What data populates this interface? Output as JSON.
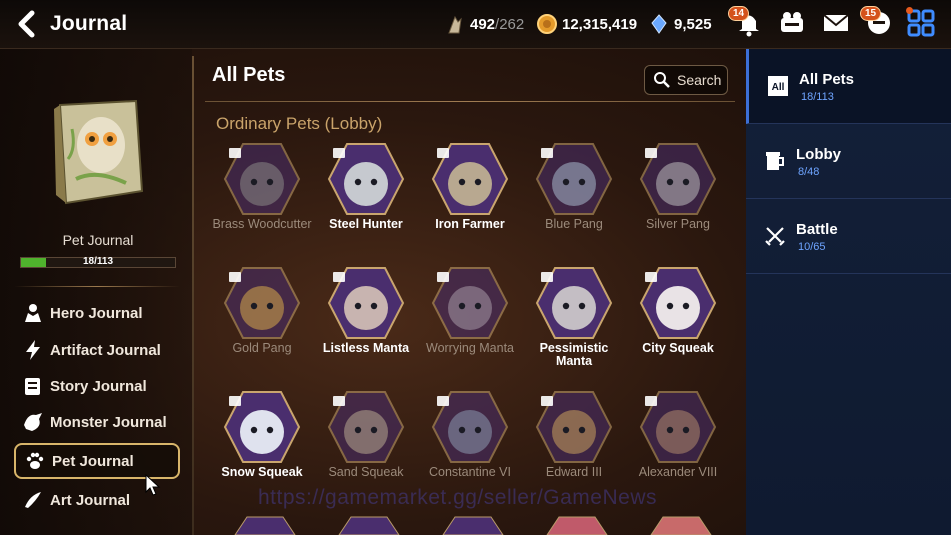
{
  "header": {
    "title": "Journal",
    "stamina": "492",
    "stamina_max": "/262",
    "gold": "12,315,419",
    "crystals": "9,525",
    "notif_badge": "14",
    "chat_badge": "15"
  },
  "left": {
    "book_label": "Pet Journal",
    "progress_text": "18/113",
    "progress_fraction": 0.16,
    "menu": [
      {
        "label": "Hero Journal",
        "icon": "hero-icon"
      },
      {
        "label": "Artifact Journal",
        "icon": "artifact-icon"
      },
      {
        "label": "Story Journal",
        "icon": "story-icon"
      },
      {
        "label": "Monster Journal",
        "icon": "monster-icon"
      },
      {
        "label": "Pet Journal",
        "icon": "paw-icon"
      },
      {
        "label": "Art Journal",
        "icon": "art-icon"
      }
    ]
  },
  "main": {
    "title": "All Pets",
    "search_label": "Search",
    "section_title": "Ordinary Pets (Lobby)",
    "pets": [
      {
        "name": "Brass Woodcutter",
        "owned": false,
        "color": "#8a8a86"
      },
      {
        "name": "Steel Hunter",
        "owned": true,
        "color": "#c6c9cf"
      },
      {
        "name": "Iron Farmer",
        "owned": true,
        "color": "#b8a890"
      },
      {
        "name": "Blue Pang",
        "owned": false,
        "color": "#a7b9cc"
      },
      {
        "name": "Silver Pang",
        "owned": false,
        "color": "#bdbdbd"
      },
      {
        "name": "Gold Pang",
        "owned": false,
        "color": "#d7a94a"
      },
      {
        "name": "Listless Manta",
        "owned": true,
        "color": "#c8b4b0"
      },
      {
        "name": "Worrying Manta",
        "owned": false,
        "color": "#a89aa8"
      },
      {
        "name": "Pessimistic Manta",
        "owned": true,
        "color": "#c4bec4"
      },
      {
        "name": "City Squeak",
        "owned": true,
        "color": "#e9e3e6"
      },
      {
        "name": "Snow Squeak",
        "owned": true,
        "color": "#dfe2ee"
      },
      {
        "name": "Sand Squeak",
        "owned": false,
        "color": "#b8a98f"
      },
      {
        "name": "Constantine VI",
        "owned": false,
        "color": "#8c9bb1"
      },
      {
        "name": "Edward III",
        "owned": false,
        "color": "#caa35c"
      },
      {
        "name": "Alexander VIII",
        "owned": false,
        "color": "#b08a6e"
      }
    ],
    "watermark": "https://gamemarket.gg/seller/GameNews"
  },
  "right": {
    "tabs": [
      {
        "label": "All Pets",
        "count": "18/113",
        "icon": "all-icon"
      },
      {
        "label": "Lobby",
        "count": "8/48",
        "icon": "mug-icon"
      },
      {
        "label": "Battle",
        "count": "10/65",
        "icon": "swords-icon"
      }
    ]
  },
  "colors": {
    "accent": "#4fb22d",
    "gold_text": "#c9a36a",
    "tab_count": "#6ea4ff"
  }
}
